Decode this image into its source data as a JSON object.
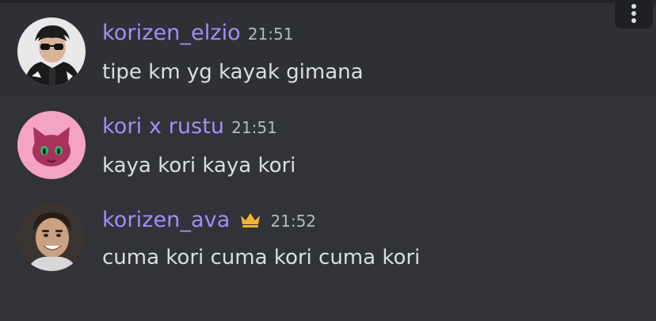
{
  "messages": [
    {
      "username": "korizen_elzio",
      "timestamp": "21:51",
      "content": "tipe km yg kayak gimana",
      "hovered": true,
      "avatar_icon": "avatar-photo-man-sunglasses"
    },
    {
      "username": "kori x rustu",
      "timestamp": "21:51",
      "content": "kaya kori kaya kori",
      "hovered": false,
      "avatar_icon": "avatar-pink-cat-cartoon"
    },
    {
      "username": "korizen_ava",
      "timestamp": "21:52",
      "content": "cuma kori cuma kori cuma kori",
      "hovered": false,
      "badge_icon": "crown-icon",
      "avatar_icon": "avatar-photo-smiling-man"
    }
  ],
  "toolbar": {
    "more_icon": "more-vertical-icon"
  },
  "colors": {
    "background": "#313338",
    "hover_background": "#2e3035",
    "username": "#a68cf6",
    "timestamp": "#b5bac1",
    "message_text": "#dbdee1",
    "crown": "#f0b232",
    "cat_avatar_bg": "#f5a3c4",
    "cat_head": "#a8325c"
  }
}
